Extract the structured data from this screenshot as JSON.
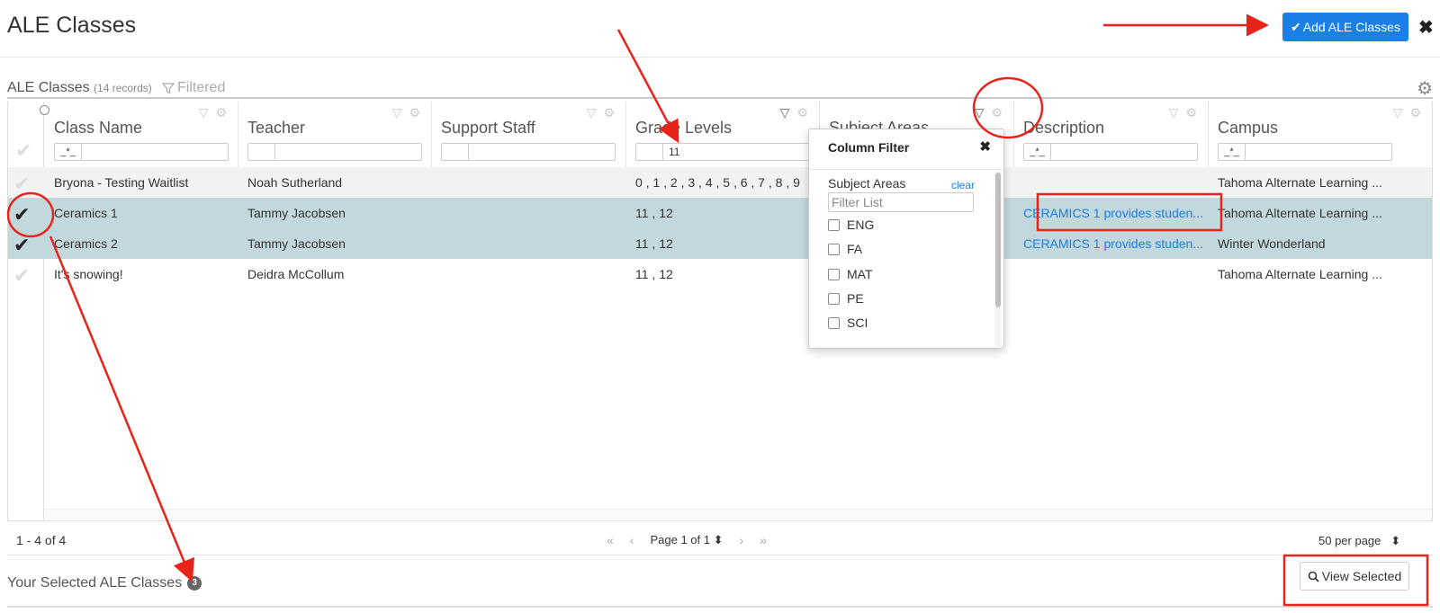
{
  "page": {
    "title": "ALE Classes",
    "add_button_label": "Add ALE Classes"
  },
  "grid": {
    "title": "ALE Classes",
    "record_count": "(14 records)",
    "filtered_label": "Filtered",
    "columns": [
      {
        "label": "Class Name",
        "filter_op": "_*_",
        "filter_value": ""
      },
      {
        "label": "Teacher",
        "filter_op": "",
        "filter_value": ""
      },
      {
        "label": "Support Staff",
        "filter_op": "",
        "filter_value": ""
      },
      {
        "label": "Grade Levels",
        "filter_op": "",
        "filter_value": "11"
      },
      {
        "label": "Subject Areas",
        "filter_op": "",
        "filter_value": ""
      },
      {
        "label": "Description",
        "filter_op": "_*_",
        "filter_value": ""
      },
      {
        "label": "Campus",
        "filter_op": "_*_",
        "filter_value": ""
      }
    ],
    "rows": [
      {
        "class_name": "Bryona - Testing Waitlist",
        "teacher": "Noah Sutherland",
        "support_staff": "",
        "grade_levels": "0 , 1 , 2 , 3 , 4 , 5 , 6 , 7 , 8 , 9",
        "description": "",
        "campus": "Tahoma Alternate Learning ..."
      },
      {
        "class_name": "Ceramics 1",
        "teacher": "Tammy Jacobsen",
        "support_staff": "",
        "grade_levels": "11 , 12",
        "description": "CERAMICS 1 provides studen...",
        "campus": "Tahoma Alternate Learning ..."
      },
      {
        "class_name": "Ceramics 2",
        "teacher": "Tammy Jacobsen",
        "support_staff": "",
        "grade_levels": "11 , 12",
        "description": "CERAMICS 1 provides studen...",
        "campus": "Winter Wonderland"
      },
      {
        "class_name": "It's snowing!",
        "teacher": "Deidra McCollum",
        "support_staff": "",
        "grade_levels": "11 , 12",
        "description": "",
        "campus": "Tahoma Alternate Learning ..."
      }
    ]
  },
  "column_filter": {
    "title": "Column Filter",
    "field_label": "Subject Areas",
    "clear_label": "clear",
    "list_placeholder": "Filter List",
    "options": [
      "ENG",
      "FA",
      "MAT",
      "PE",
      "SCI"
    ]
  },
  "footer": {
    "range": "1 - 4 of 4",
    "page_label": "Page 1 of 1",
    "per_page": "50 per page"
  },
  "selected": {
    "title": "Your Selected ALE Classes",
    "count": "3",
    "view_button_label": "View Selected"
  },
  "colors": {
    "accent": "#1a7fe6",
    "selected_row": "#c2d8dc",
    "annotation": "#e8231a"
  }
}
